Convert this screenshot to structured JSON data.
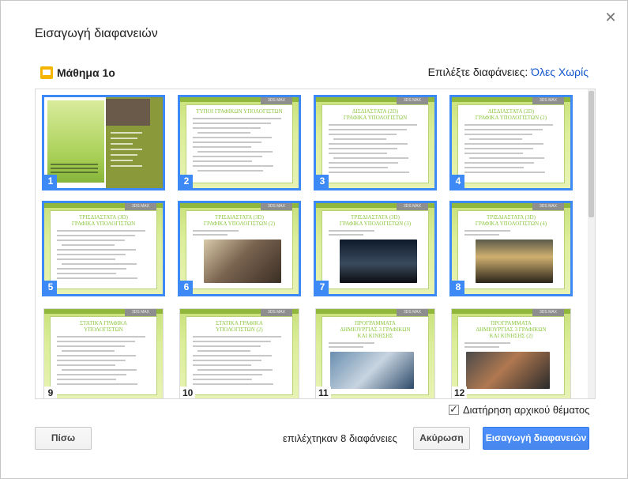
{
  "dialog": {
    "title": "Εισαγωγή διαφανειών",
    "close_icon": "close-icon"
  },
  "presentation": {
    "name": "Μάθημα 1ο",
    "icon": "slides-icon"
  },
  "select": {
    "label": "Επιλέξτε διαφάνειες:",
    "all": "Όλες",
    "none": "Χωρίς"
  },
  "slides": [
    {
      "number": "1",
      "selected": true
    },
    {
      "number": "2",
      "selected": true,
      "tag": "3DS MAX",
      "title": "ΤΥΠΟΙ ΓΡΑΦΙΚΩΝ ΥΠΟΛΟΓΙΣΤΩΝ"
    },
    {
      "number": "3",
      "selected": true,
      "tag": "3DS MAX",
      "title": "ΔΙΣΔΙΑΣΤΑΤΑ (2D)\nΓΡΑΦΙΚΑ ΥΠΟΛΟΓΙΣΤΩΝ"
    },
    {
      "number": "4",
      "selected": true,
      "tag": "3DS MAX",
      "title": "ΔΙΣΔΙΑΣΤΑΤΑ (2D)\nΓΡΑΦΙΚΑ ΥΠΟΛΟΓΙΣΤΩΝ (2)"
    },
    {
      "number": "5",
      "selected": true,
      "tag": "3DS MAX",
      "title": "ΤΡΙΣΔΙΑΣΤΑΤΑ (3D)\nΓΡΑΦΙΚΑ ΥΠΟΛΟΓΙΣΤΩΝ"
    },
    {
      "number": "6",
      "selected": true,
      "tag": "3DS MAX",
      "title": "ΤΡΙΣΔΙΑΣΤΑΤΑ (3D)\nΓΡΑΦΙΚΑ ΥΠΟΛΟΓΙΣΤΩΝ (2)"
    },
    {
      "number": "7",
      "selected": true,
      "tag": "3DS MAX",
      "title": "ΤΡΙΣΔΙΑΣΤΑΤΑ (3D)\nΓΡΑΦΙΚΑ ΥΠΟΛΟΓΙΣΤΩΝ (3)"
    },
    {
      "number": "8",
      "selected": true,
      "tag": "3DS MAX",
      "title": "ΤΡΙΣΔΙΑΣΤΑΤΑ (3D)\nΓΡΑΦΙΚΑ ΥΠΟΛΟΓΙΣΤΩΝ (4)"
    },
    {
      "number": "9",
      "selected": false,
      "tag": "3DS MAX",
      "title": "ΣΤΑΤΙΚΑ ΓΡΑΦΙΚΑ\nΥΠΟΛΟΓΙΣΤΩΝ"
    },
    {
      "number": "10",
      "selected": false,
      "tag": "3DS MAX",
      "title": "ΣΤΑΤΙΚΑ ΓΡΑΦΙΚΑ\nΥΠΟΛΟΓΙΣΤΩΝ (2)"
    },
    {
      "number": "11",
      "selected": false,
      "tag": "3DS MAX",
      "title": "ΠΡΟΓΡΑΜΜΑΤΑ\nΔΗΜΙΟΥΡΓΙΑΣ 3 ΓΡΑΦΙΚΩΝ\nΚΑΙ ΚΙΝΗΣΗΣ"
    },
    {
      "number": "12",
      "selected": false,
      "tag": "3DS MAX",
      "title": "ΠΡΟΓΡΑΜΜΑΤΑ\nΔΗΜΙΟΥΡΓΙΑΣ 3 ΓΡΑΦΙΚΩΝ\nΚΑΙ ΚΙΝΗΣΗΣ (2)"
    }
  ],
  "keep_theme": {
    "label": "Διατήρηση αρχικού θέματος",
    "checked": true
  },
  "footer": {
    "back": "Πίσω",
    "status": "επιλέχτηκαν 8 διαφάνειες",
    "cancel": "Ακύρωση",
    "insert": "Εισαγωγή διαφανειών"
  },
  "colors": {
    "accent": "#3d8af7",
    "primary_button": "#4d90fe",
    "link": "#1155cc",
    "slide_title": "#8cc63f"
  }
}
